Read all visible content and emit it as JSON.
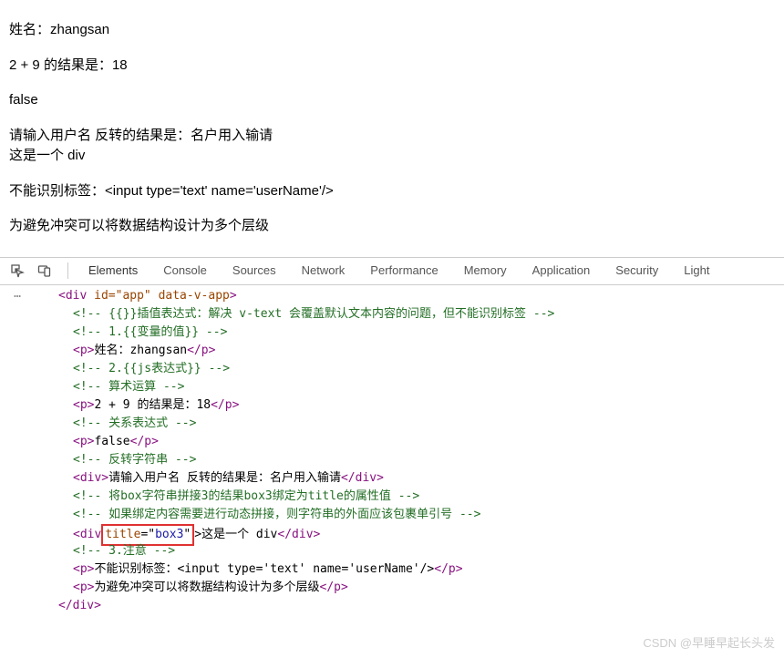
{
  "page": {
    "line1": "姓名：zhangsan",
    "line2": "2 + 9 的结果是：18",
    "line3": "false",
    "line4": "请输入用户名 反转的结果是：名户用入输请",
    "line5": "这是一个 div",
    "line6": "不能识别标签：<input type='text' name='userName'/>",
    "line7": "为避免冲突可以将数据结构设计为多个层级"
  },
  "devtools": {
    "tabs": {
      "elements": "Elements",
      "console": "Console",
      "sources": "Sources",
      "network": "Network",
      "performance": "Performance",
      "memory": "Memory",
      "application": "Application",
      "security": "Security",
      "lighthouse": "Light"
    }
  },
  "code": {
    "l0_open": "<div",
    "l0_attr": " id=\"app\" data-v-app",
    "l0_close": ">",
    "l1": "<!-- {{}}插值表达式：解决 v-text 会覆盖默认文本内容的问题，但不能识别标签 -->",
    "l2": "<!-- 1.{{变量的值}} -->",
    "l3_open": "<p>",
    "l3_text": "姓名：zhangsan",
    "l3_close": "</p>",
    "l4": "<!-- 2.{{js表达式}} -->",
    "l5": "<!-- 算术运算 -->",
    "l6_open": "<p>",
    "l6_text": "2 + 9 的结果是：18",
    "l6_close": "</p>",
    "l7": "<!-- 关系表达式 -->",
    "l8_open": "<p>",
    "l8_text": "false",
    "l8_close": "</p>",
    "l9": "<!-- 反转字符串 -->",
    "l10_open": "<div>",
    "l10_text": "请输入用户名 反转的结果是：名户用入输请",
    "l10_close": "</div>",
    "l11": "<!-- 将box字符串拼接3的结果box3绑定为title的属性值 -->",
    "l12": "<!-- 如果绑定内容需要进行动态拼接，则字符串的外面应该包裹单引号 -->",
    "l13_open": "<div",
    "l13_attr_name": " title",
    "l13_attr_eq": "=\"",
    "l13_attr_val": "box3",
    "l13_attr_q": "\"",
    "l13_text": ">这是一个 div",
    "l13_close": "</div>",
    "l14": "<!-- 3.注意 -->",
    "l15_open": "<p>",
    "l15_text": "不能识别标签：<input type='text' name='userName'/>",
    "l15_close": "</p>",
    "l16_open": "<p>",
    "l16_text": "为避免冲突可以将数据结构设计为多个层级",
    "l16_close": "</p>",
    "l17": "</div>"
  },
  "watermark": "CSDN @早睡早起长头发"
}
